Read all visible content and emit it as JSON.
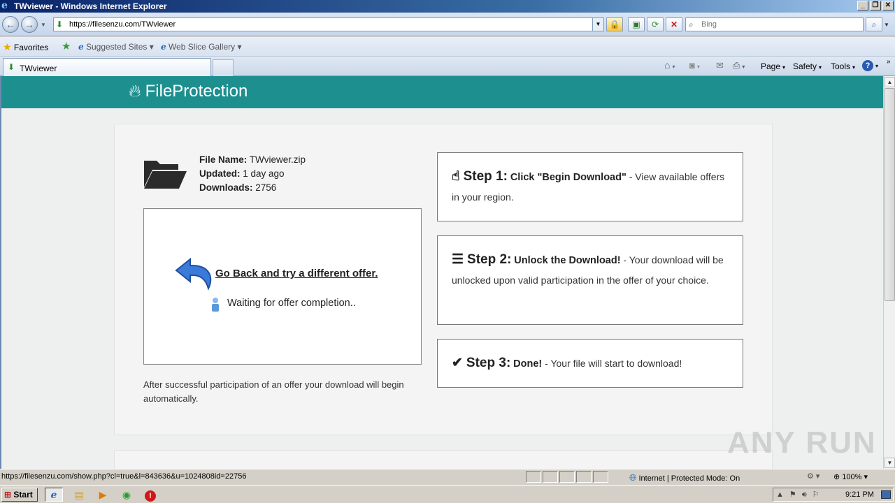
{
  "window": {
    "title": "TWviewer - Windows Internet Explorer"
  },
  "addressbar": {
    "url": "https://filesenzu.com/TWviewer",
    "search_placeholder": "Bing"
  },
  "favorites": {
    "label": "Favorites",
    "links": [
      "Suggested Sites",
      "Web Slice Gallery"
    ]
  },
  "tab": {
    "label": "TWviewer"
  },
  "commandbar": {
    "page": "Page",
    "safety": "Safety",
    "tools": "Tools"
  },
  "site": {
    "brand": "FileProtection",
    "file": {
      "name_label": "File Name:",
      "name": "TWviewer.zip",
      "updated_label": "Updated:",
      "updated": "1 day ago",
      "downloads_label": "Downloads:",
      "downloads": "2756"
    },
    "offer": {
      "go_back": "Go Back and try a different offer.",
      "waiting": "Waiting for offer completion.."
    },
    "after_text": "After successful participation of an offer your download will begin automatically.",
    "steps": [
      {
        "title": "Step 1:",
        "bold": "Click \"Begin Download\"",
        "text": " - View available offers in your region."
      },
      {
        "title": "Step 2:",
        "bold": "Unlock the Download!",
        "text": " - Your download will be unlocked upon valid participation in the offer of your choice."
      },
      {
        "title": "Step 3:",
        "bold": "Done!",
        "text": " - Your file will start to download!"
      }
    ]
  },
  "watermark": "ANY RUN",
  "statusbar": {
    "url": "https://filesenzu.com/show.php?cl=true&l=843636&u=1024808id=22756",
    "zone": "Internet | Protected Mode: On",
    "zoom": "100%"
  },
  "taskbar": {
    "start": "Start",
    "clock": "9:21 PM"
  },
  "colors": {
    "header": "#1e8f8f",
    "card": "#f4f4f4"
  }
}
